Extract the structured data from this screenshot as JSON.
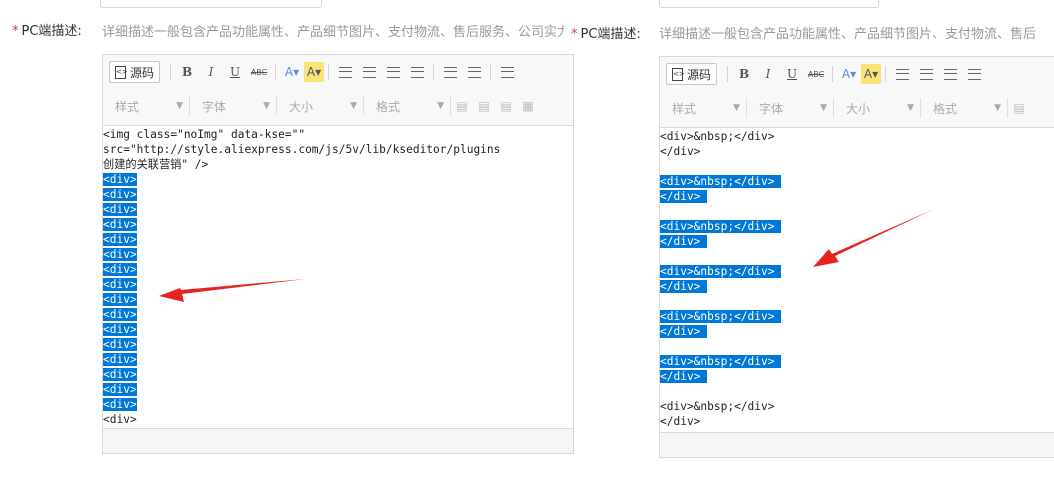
{
  "left": {
    "required_mark": "*",
    "label": "PC端描述:",
    "hint": "详细描述一般包含产品功能属性、产品细节图片、支付物流、售后服务、公司实力",
    "toolbar": {
      "source_btn": "源码",
      "bold": "B",
      "italic": "I",
      "underline": "U",
      "strike": "ABC",
      "font_color": "A▾",
      "highlight": "A▾",
      "style_dd": "样式",
      "font_dd": "字体",
      "size_dd": "大小",
      "format_dd": "格式"
    },
    "code_lines": [
      "<img class=\"noImg\" data-kse=\"\"",
      "src=\"http://style.aliexpress.com/js/5v/lib/kseditor/plugins",
      "创建的关联营销\" />",
      "<div>",
      "<div>",
      "<div>",
      "<div>",
      "<div>",
      "<div>",
      "<div>",
      "<div>",
      "<div>",
      "<div>",
      "<div>",
      "<div>",
      "<div>",
      "<div>",
      "<div>",
      "<div>",
      "<div>"
    ]
  },
  "right": {
    "required_mark": "*",
    "label": "PC端描述:",
    "hint": "详细描述一般包含产品功能属性、产品细节图片、支付物流、售后",
    "toolbar": {
      "source_btn": "源码",
      "bold": "B",
      "italic": "I",
      "underline": "U",
      "strike": "ABC",
      "font_color": "A▾",
      "highlight": "A▾",
      "style_dd": "样式",
      "font_dd": "字体",
      "size_dd": "大小",
      "format_dd": "格式"
    },
    "code_lines": [
      "<div>&nbsp;</div>",
      "</div>",
      "",
      "<div>&nbsp;</div> ",
      "</div> ",
      "",
      "<div>&nbsp;</div> ",
      "</div> ",
      "",
      "<div>&nbsp;</div> ",
      "</div> ",
      "",
      "<div>&nbsp;</div> ",
      "</div> ",
      "",
      "<div>&nbsp;</div> ",
      "</div> ",
      "",
      "<div>&nbsp;</div>",
      "</div>"
    ]
  },
  "annotation_color": "#e8231f",
  "selection_color": "#0078d7"
}
